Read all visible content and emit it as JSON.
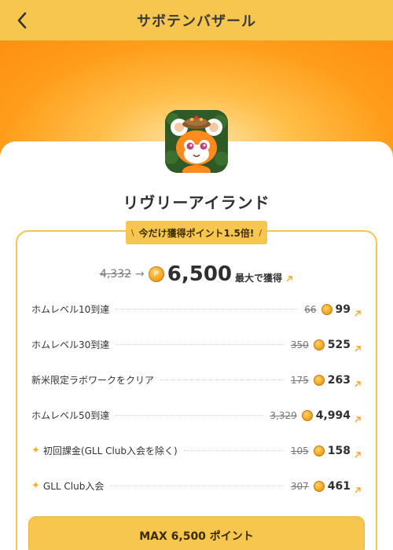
{
  "header": {
    "title": "サボテンバザール",
    "back_icon": "chevron-left-icon"
  },
  "app": {
    "name": "リヴリーアイランド",
    "icon": "app-icon"
  },
  "promo": {
    "label": "今だけ獲得ポイント1.5倍!",
    "left_mark": "\\",
    "right_mark": "/"
  },
  "total": {
    "old": "4,332",
    "arrow": "→",
    "new": "6,500",
    "suffix": "最大で獲得",
    "coin_letter": "P"
  },
  "rows": [
    {
      "label": "ホムレベル10到達",
      "old": "66",
      "new": "99",
      "star": false
    },
    {
      "label": "ホムレベル30到達",
      "old": "350",
      "new": "525",
      "star": false
    },
    {
      "label": "新米限定ラボワークをクリア",
      "old": "175",
      "new": "263",
      "star": false
    },
    {
      "label": "ホムレベル50到達",
      "old": "3,329",
      "new": "4,994",
      "star": false
    },
    {
      "label": "初回課金(GLL Club入会を除く)",
      "old": "105",
      "new": "158",
      "star": true
    },
    {
      "label": "GLL Club入会",
      "old": "307",
      "new": "461",
      "star": true
    }
  ],
  "cta": {
    "label": "MAX 6,500 ポイント"
  },
  "colors": {
    "accent": "#f6c64e",
    "hero": "#ff9d1a",
    "ext_arrow": "#f2a623"
  }
}
